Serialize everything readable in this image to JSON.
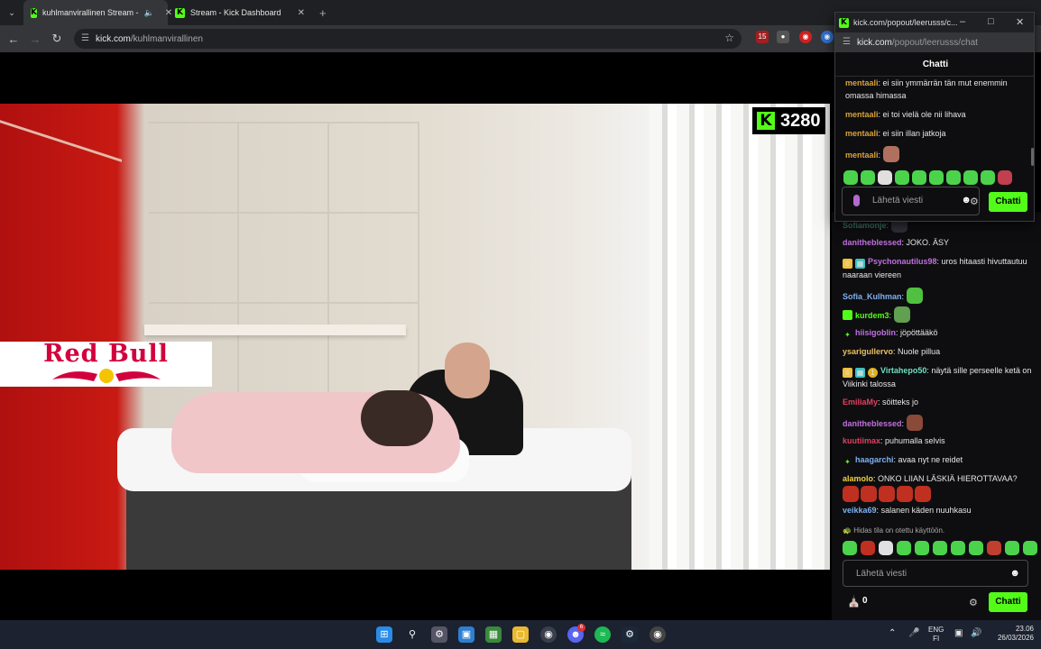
{
  "browser": {
    "tabs": [
      {
        "title": "kuhlmanvirallinen Stream -",
        "active": true
      },
      {
        "title": "Stream - Kick Dashboard",
        "active": false
      }
    ],
    "url_host": "kick.com",
    "url_path": "/kuhlmanvirallinen",
    "extension_badge": "15"
  },
  "stream": {
    "viewer_count": "3280",
    "overlay_text": "Red Bull"
  },
  "popout": {
    "window_title": "kick.com/popout/leerusss/c...",
    "url_host": "kick.com",
    "url_path": "/popout/leerusss/chat",
    "header": "Chatti",
    "messages": [
      {
        "user": "mentaali",
        "text": "ei siin ymmärrän tän mut enemmin omassa himassa"
      },
      {
        "user": "mentaali",
        "text": "ei toi vielä ole nii lihava"
      },
      {
        "user": "mentaali",
        "text": "ei siin illan jatkoja"
      },
      {
        "user": "mentaali",
        "text": ""
      }
    ],
    "input_placeholder": "Lähetä viesti",
    "send_label": "Chatti"
  },
  "chat": {
    "messages": [
      {
        "user": "danitheblessed",
        "text": "JOKO. ÄSY"
      },
      {
        "user": "Psychonautilus98",
        "text": "uros hitaasti hivuttautuu naaraan viereen"
      },
      {
        "user": "Sofia_Kulhman",
        "text": ""
      },
      {
        "user": "kurdem3",
        "text": ""
      },
      {
        "user": "hiisigoblin",
        "text": "jöpöttääkö"
      },
      {
        "user": "ysarigullervo",
        "text": "Nuole pillua"
      },
      {
        "user": "Virtahepo50",
        "text": "näytä sille perseelle ketä on Viikinki talossa"
      },
      {
        "user": "EmiliaMy",
        "text": "söitteks jo"
      },
      {
        "user": "danitheblessed",
        "text": ""
      },
      {
        "user": "kuutiimax",
        "text": "puhumalla selvis"
      },
      {
        "user": "haagarchi",
        "text": "avaa nyt ne reidet"
      },
      {
        "user": "alamolo",
        "text": "ONKO LIIAN LÄSKIÄ HIEROTTAVAA?"
      },
      {
        "user": "veikka69",
        "text": "salanen käden nuuhkasu"
      }
    ],
    "slow_mode_note": "Hidas tila on otettu käyttöön.",
    "input_placeholder": "Lähetä viesti",
    "send_label": "Chatti",
    "points": "0"
  },
  "taskbar": {
    "discord_badge": "6",
    "lang": "ENG",
    "region": "FI",
    "time": "23.06",
    "date": "26/03/2026"
  },
  "colors": {
    "kick_green": "#53fc18",
    "mentaali": "#d9a23a",
    "danitheblessed": "#c070e0",
    "Psychonautilus98": "#c070e0",
    "Sofia_Kulhman": "#7fb0f0",
    "kurdem3": "#53fc18",
    "hiisigoblin": "#c070e0",
    "ysarigullervo": "#e8c060",
    "Virtahepo50": "#6fe0c0",
    "EmiliaMy": "#e04060",
    "kuutiimax": "#e04060",
    "haagarchi": "#7fb0f0",
    "alamolo": "#f0d040",
    "veikka69": "#7fb0f0"
  }
}
